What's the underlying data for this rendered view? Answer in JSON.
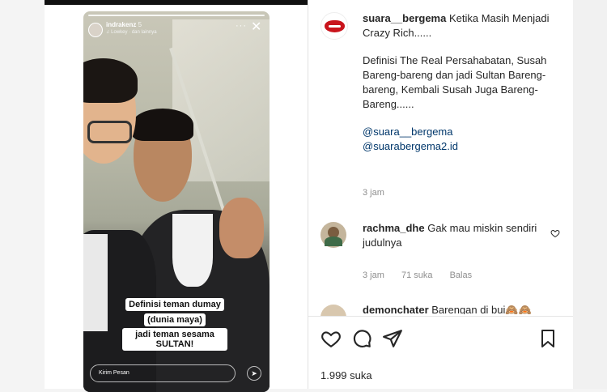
{
  "story": {
    "username": "indrakenz",
    "time": "5",
    "subtitle": "♫ Lowkey · dan lainnya",
    "caption_lines": [
      "Definisi teman dumay",
      "(dunia maya)",
      "jadi teman sesama SULTAN!"
    ],
    "reply_placeholder": "Kirim Pesan",
    "dots_icon": "···",
    "close_icon": "✕",
    "share_icon": "➤"
  },
  "post": {
    "author": "suara__bergema",
    "caption_title": "Ketika Masih Menjadi Crazy Rich......",
    "caption_body": "Definisi The Real Persahabatan, Susah Bareng-bareng dan jadi Sultan Bareng-bareng, Kembali Susah Juga Bareng-Bareng......",
    "mentions": [
      "@suara__bergema",
      "@suarabergema2.id"
    ],
    "time": "3 jam",
    "comments": [
      {
        "user": "rachma_dhe",
        "text": "Gak mau miskin sendiri judulnya",
        "time": "3 jam",
        "likes": "71 suka",
        "reply": "Balas"
      },
      {
        "user": "demonchater",
        "text": "Barengan di bui🙈🙈"
      }
    ],
    "likes": "1.999 suka",
    "colors": {
      "brand_red": "#c9141c",
      "link": "#00376b",
      "muted": "#8e8e8e"
    }
  },
  "icons": {
    "heart": "heart-icon",
    "comment": "comment-icon",
    "share": "share-icon",
    "save": "bookmark-icon"
  }
}
